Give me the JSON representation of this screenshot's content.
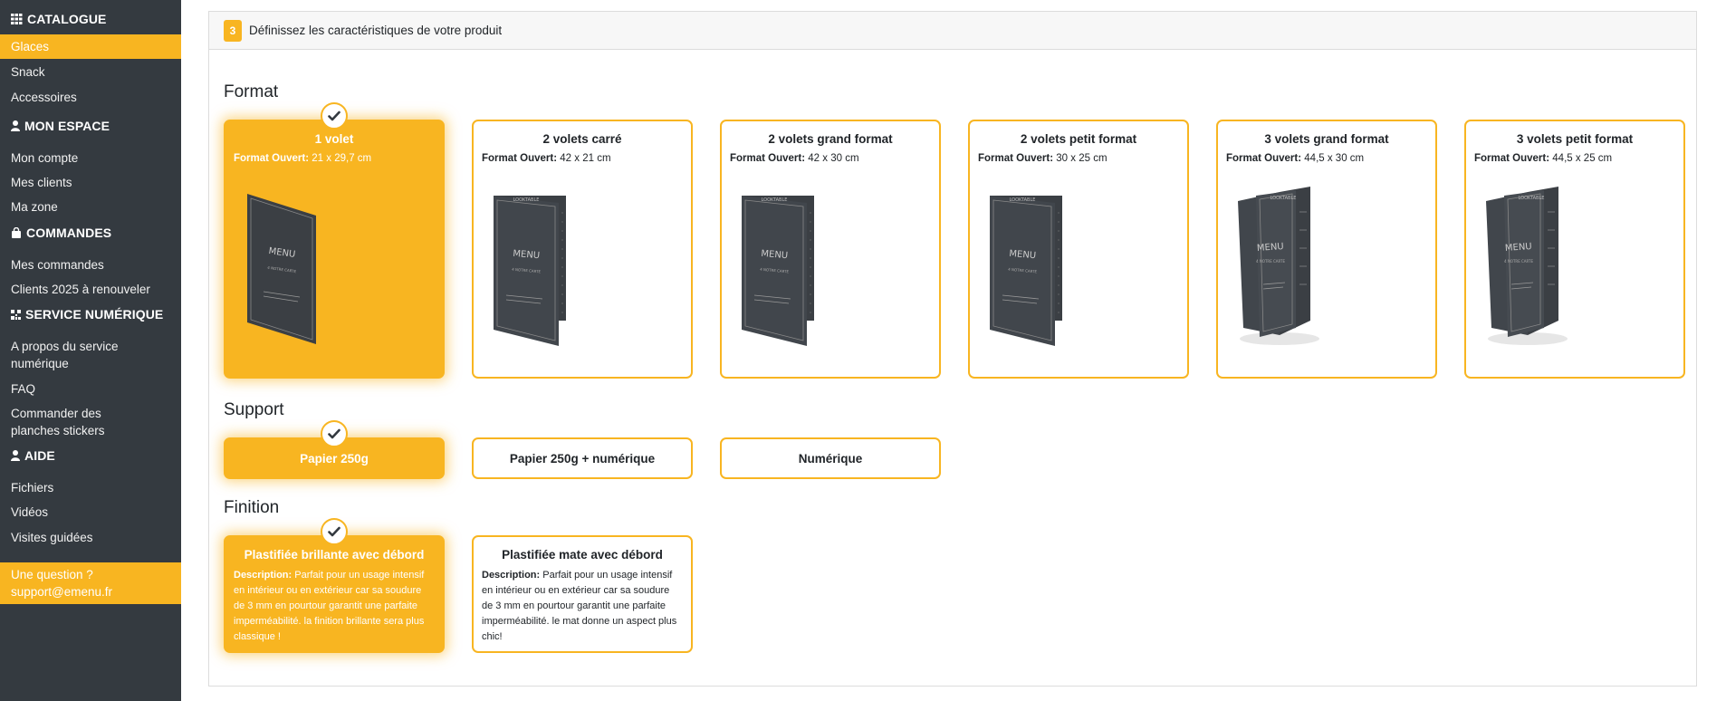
{
  "colors": {
    "accent": "#f8b521",
    "sidebar_bg": "#343a40"
  },
  "sidebar": {
    "sections": [
      {
        "title": "CATALOGUE",
        "icon": "grid-icon",
        "items": [
          "Glaces",
          "Snack",
          "Accessoires"
        ]
      },
      {
        "title": "MON ESPACE",
        "icon": "user-icon",
        "items": [
          "Mon compte",
          "Mes clients",
          "Ma zone"
        ]
      },
      {
        "title": "COMMANDES",
        "icon": "shopping-bag-icon",
        "items": [
          "Mes commandes",
          "Clients 2025 à renouveler"
        ]
      },
      {
        "title": "SERVICE NUMÉRIQUE",
        "icon": "qrcode-icon",
        "items": [
          "A propos du service numérique",
          "FAQ",
          "Commander des planches stickers"
        ]
      },
      {
        "title": "AIDE",
        "icon": "user-icon",
        "items": [
          "Fichiers",
          "Vidéos",
          "Visites guidées"
        ]
      }
    ],
    "active_item": "Glaces",
    "help": {
      "line1": "Une question ?",
      "line2": "support@emenu.fr"
    }
  },
  "panel": {
    "step": "3",
    "title": "Définissez les caractéristiques de votre produit"
  },
  "format": {
    "title": "Format",
    "open_label": "Format Ouvert:",
    "options": [
      {
        "name": "1 volet",
        "size": "21 x 29,7 cm",
        "selected": true
      },
      {
        "name": "2 volets carré",
        "size": "42 x 21 cm",
        "selected": false
      },
      {
        "name": "2 volets grand format",
        "size": "42 x 30 cm",
        "selected": false
      },
      {
        "name": "2 volets petit format",
        "size": "30 x 25 cm",
        "selected": false
      },
      {
        "name": "3 volets grand format",
        "size": "44,5 x 30 cm",
        "selected": false
      },
      {
        "name": "3 volets petit format",
        "size": "44,5 x 25 cm",
        "selected": false
      }
    ]
  },
  "support": {
    "title": "Support",
    "options": [
      {
        "name": "Papier 250g",
        "selected": true
      },
      {
        "name": "Papier 250g + numérique",
        "selected": false
      },
      {
        "name": "Numérique",
        "selected": false
      }
    ]
  },
  "finition": {
    "title": "Finition",
    "desc_label": "Description:",
    "options": [
      {
        "name": "Plastifiée brillante avec débord",
        "desc": "Parfait pour un usage intensif en intérieur ou en extérieur car sa soudure de 3 mm en pourtour garantit une parfaite imperméabilité. la finition brillante sera plus classique !",
        "selected": true
      },
      {
        "name": "Plastifiée mate avec débord",
        "desc": "Parfait pour un usage intensif en intérieur ou en extérieur car sa soudure de 3 mm en pourtour garantit une parfaite imperméabilité. le mat donne un aspect plus chic!",
        "selected": false
      }
    ]
  },
  "menu_image_text": {
    "title": "MENU",
    "subtitle": "4 NOTRE CARTE",
    "top": "LOOKTABLE"
  }
}
